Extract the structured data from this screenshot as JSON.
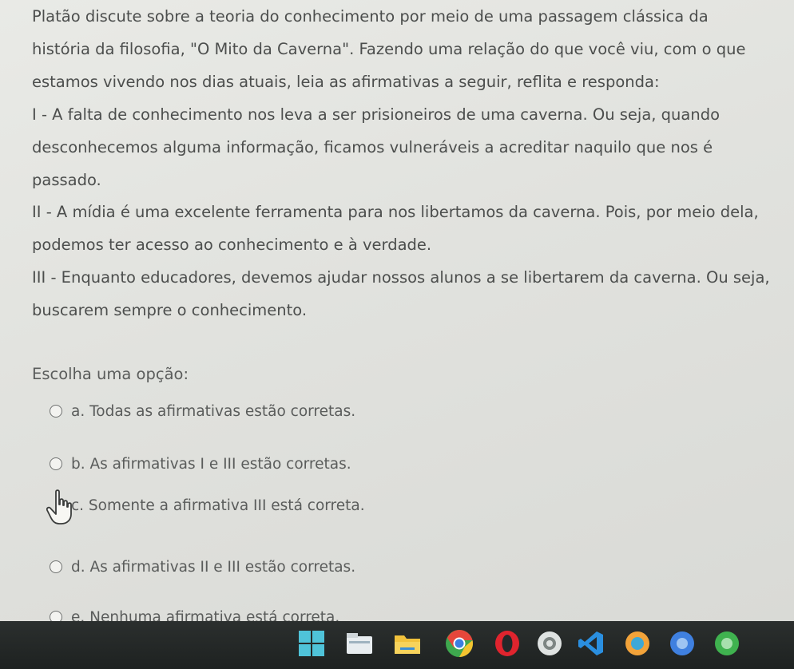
{
  "question": {
    "intro_lines": [
      "Platão discute sobre a teoria do conhecimento por meio de uma passagem clássica da",
      "história da filosofia, \"O Mito da Caverna\". Fazendo uma relação do que você viu, com o que",
      "estamos vivendo nos dias atuais, leia as afirmativas a seguir, reflita e responda:"
    ],
    "statement_1": [
      "I - A falta de conhecimento nos leva a ser prisioneiros de uma caverna. Ou seja, quando",
      "desconhecemos alguma informação, ficamos vulneráveis a acreditar naquilo que nos é",
      "passado."
    ],
    "statement_2": [
      "II - A mídia é uma excelente ferramenta para nos libertamos da caverna. Pois, por meio dela,",
      "podemos ter acesso ao conhecimento e à verdade."
    ],
    "statement_3": [
      "III - Enquanto educadores, devemos ajudar nossos alunos a se libertarem da caverna. Ou seja,",
      "buscarem sempre o conhecimento."
    ],
    "choose_label": "Escolha uma opção:"
  },
  "options": [
    {
      "text": "a. Todas as afirmativas estão corretas."
    },
    {
      "text": "b. As afirmativas I e III estão corretas."
    },
    {
      "text": "c. Somente a afirmativa III está correta."
    },
    {
      "text": "d. As afirmativas II e III estão corretas."
    },
    {
      "text": "e. Nenhuma afirmativa está correta."
    }
  ],
  "taskbar": {
    "icons": [
      "windows-start-icon",
      "file-explorer-icon",
      "folder-icon",
      "chrome-icon",
      "opera-icon",
      "app-icon",
      "vscode-icon",
      "app-icon",
      "app-icon",
      "app-icon"
    ]
  },
  "colors": {
    "page_background": "#e1e2de",
    "text": "#4c4e4d",
    "taskbar": "#24282a"
  }
}
